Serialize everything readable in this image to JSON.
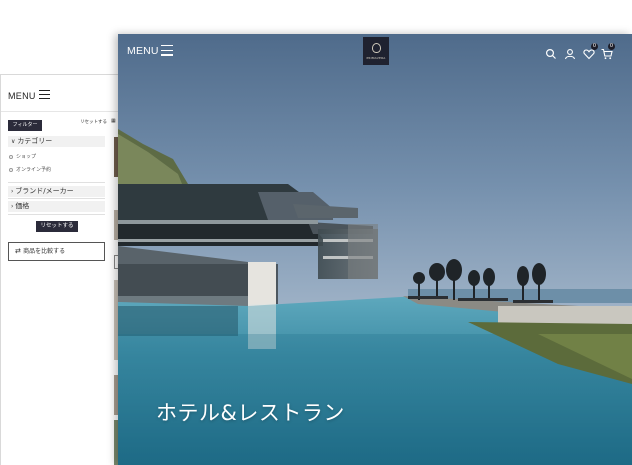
{
  "back_window": {
    "menu_label": "MENU",
    "filter_button": "フィルター",
    "reset_top_link": "リセットする",
    "category_header": "カテゴリー",
    "category_items": [
      "ショップ",
      "オンライン予約"
    ],
    "brand_header": "ブランド/メーカー",
    "price_header": "価格",
    "reset_button": "リセットする",
    "compare_button": "商品を比較する",
    "compare_icon": "shuffle-icon"
  },
  "front_window": {
    "menu_label": "MENU",
    "logo_text": "PRIMAVERA",
    "header_icons": [
      "search-icon",
      "user-icon",
      "heart-icon",
      "cart-icon"
    ],
    "wishlist_count": "0",
    "cart_count": "0",
    "hero_title": "ホテル&レストラン"
  },
  "colors": {
    "sky_top": "#4f6b8b",
    "water": "#3f8ea6",
    "dark_button": "#2b2b3a",
    "logo_bg": "#1f2230"
  }
}
